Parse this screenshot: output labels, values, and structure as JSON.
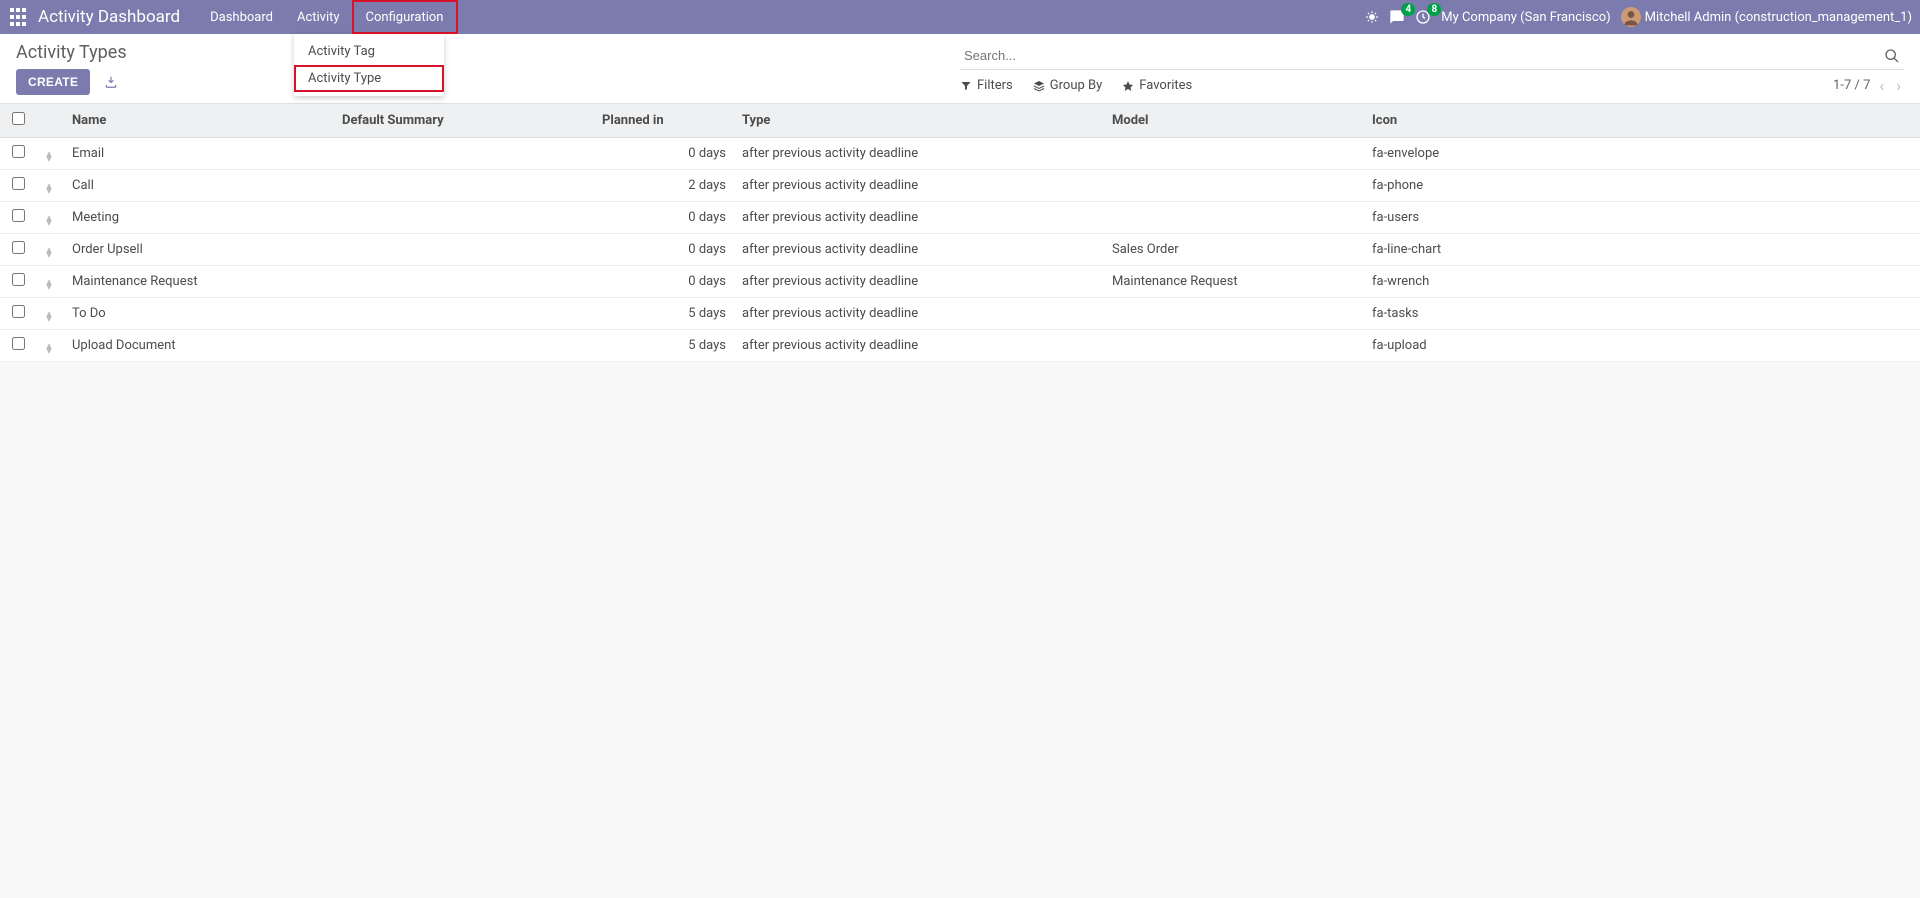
{
  "topnav": {
    "brand": "Activity Dashboard",
    "links": [
      "Dashboard",
      "Activity",
      "Configuration"
    ],
    "chat_badge": "4",
    "clock_badge": "8",
    "company": "My Company (San Francisco)",
    "user": "Mitchell Admin (construction_management_1)"
  },
  "dropdown": {
    "items": [
      "Activity Tag",
      "Activity Type"
    ]
  },
  "breadcrumb": "Activity Types",
  "buttons": {
    "create": "CREATE"
  },
  "search": {
    "placeholder": "Search..."
  },
  "filters": {
    "filters": "Filters",
    "groupby": "Group By",
    "favorites": "Favorites"
  },
  "pager": {
    "range": "1-7 / 7"
  },
  "table": {
    "headers": {
      "name": "Name",
      "summary": "Default Summary",
      "planned": "Planned in",
      "type": "Type",
      "model": "Model",
      "icon": "Icon"
    },
    "rows": [
      {
        "name": "Email",
        "summary": "",
        "planned": "0 days",
        "type": "after previous activity deadline",
        "model": "",
        "icon": "fa-envelope"
      },
      {
        "name": "Call",
        "summary": "",
        "planned": "2 days",
        "type": "after previous activity deadline",
        "model": "",
        "icon": "fa-phone"
      },
      {
        "name": "Meeting",
        "summary": "",
        "planned": "0 days",
        "type": "after previous activity deadline",
        "model": "",
        "icon": "fa-users"
      },
      {
        "name": "Order Upsell",
        "summary": "",
        "planned": "0 days",
        "type": "after previous activity deadline",
        "model": "Sales Order",
        "icon": "fa-line-chart"
      },
      {
        "name": "Maintenance Request",
        "summary": "",
        "planned": "0 days",
        "type": "after previous activity deadline",
        "model": "Maintenance Request",
        "icon": "fa-wrench"
      },
      {
        "name": "To Do",
        "summary": "",
        "planned": "5 days",
        "type": "after previous activity deadline",
        "model": "",
        "icon": "fa-tasks"
      },
      {
        "name": "Upload Document",
        "summary": "",
        "planned": "5 days",
        "type": "after previous activity deadline",
        "model": "",
        "icon": "fa-upload"
      }
    ]
  }
}
